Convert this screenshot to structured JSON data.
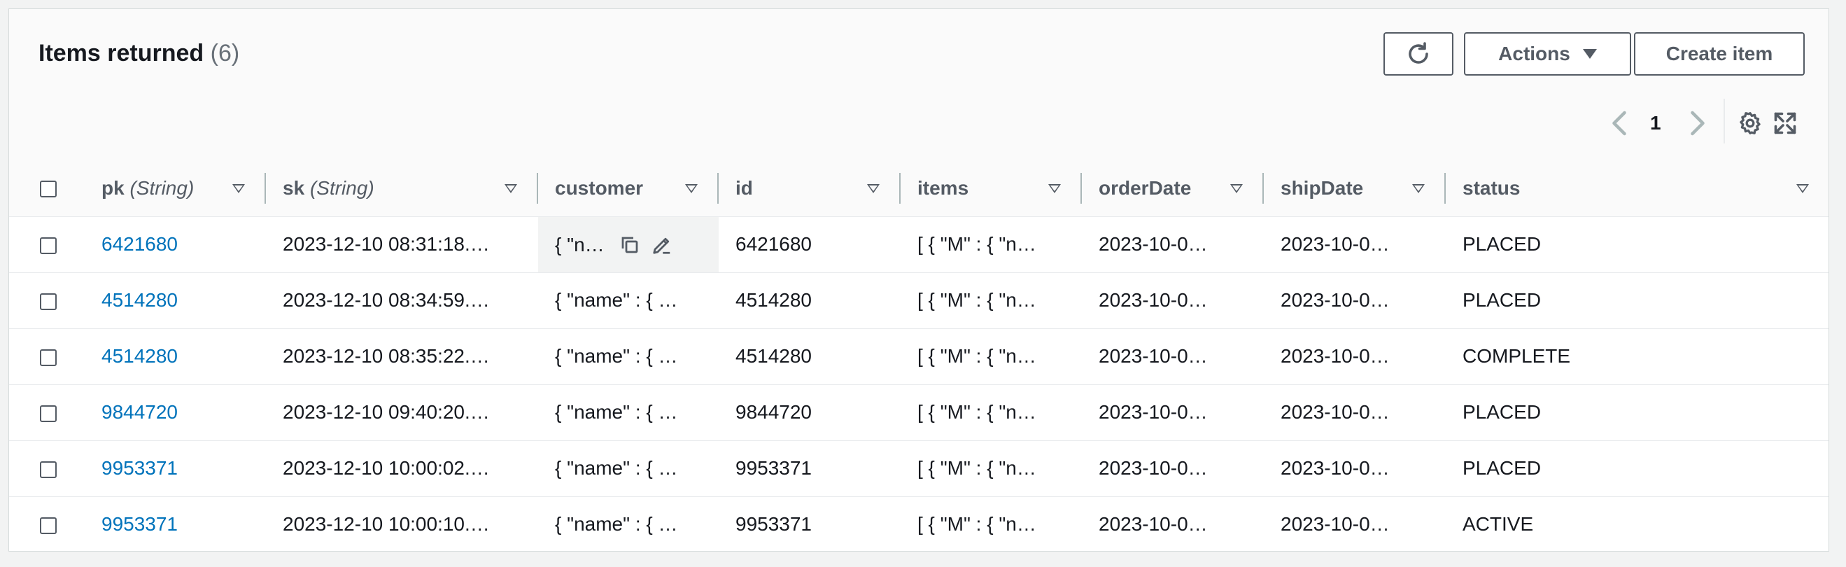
{
  "header": {
    "title": "Items returned",
    "count": "(6)",
    "actions_label": "Actions",
    "create_label": "Create item",
    "page_number": "1"
  },
  "columns": [
    {
      "name": "pk",
      "type": "(String)"
    },
    {
      "name": "sk",
      "type": "(String)"
    },
    {
      "name": "customer",
      "type": ""
    },
    {
      "name": "id",
      "type": ""
    },
    {
      "name": "items",
      "type": ""
    },
    {
      "name": "orderDate",
      "type": ""
    },
    {
      "name": "shipDate",
      "type": ""
    },
    {
      "name": "status",
      "type": ""
    }
  ],
  "rows": [
    {
      "pk": "6421680",
      "sk": "2023-12-10 08:31:18.…",
      "customer": "{ \"n…",
      "id": "6421680",
      "items": "[ { \"M\" : { \"n…",
      "orderDate": "2023-10-0…",
      "shipDate": "2023-10-0…",
      "status": "PLACED"
    },
    {
      "pk": "4514280",
      "sk": "2023-12-10 08:34:59.…",
      "customer": "{ \"name\" : { …",
      "id": "4514280",
      "items": "[ { \"M\" : { \"n…",
      "orderDate": "2023-10-0…",
      "shipDate": "2023-10-0…",
      "status": "PLACED"
    },
    {
      "pk": "4514280",
      "sk": "2023-12-10 08:35:22.…",
      "customer": "{ \"name\" : { …",
      "id": "4514280",
      "items": "[ { \"M\" : { \"n…",
      "orderDate": "2023-10-0…",
      "shipDate": "2023-10-0…",
      "status": "COMPLETE"
    },
    {
      "pk": "9844720",
      "sk": "2023-12-10 09:40:20.…",
      "customer": "{ \"name\" : { …",
      "id": "9844720",
      "items": "[ { \"M\" : { \"n…",
      "orderDate": "2023-10-0…",
      "shipDate": "2023-10-0…",
      "status": "PLACED"
    },
    {
      "pk": "9953371",
      "sk": "2023-12-10 10:00:02.…",
      "customer": "{ \"name\" : { …",
      "id": "9953371",
      "items": "[ { \"M\" : { \"n…",
      "orderDate": "2023-10-0…",
      "shipDate": "2023-10-0…",
      "status": "PLACED"
    },
    {
      "pk": "9953371",
      "sk": "2023-12-10 10:00:10.…",
      "customer": "{ \"name\" : { …",
      "id": "9953371",
      "items": "[ { \"M\" : { \"n…",
      "orderDate": "2023-10-0…",
      "shipDate": "2023-10-0…",
      "status": "ACTIVE"
    }
  ],
  "icons": {
    "refresh": "refresh-icon",
    "actions_caret": "caret-down-icon",
    "prev": "chevron-left-icon",
    "next": "chevron-right-icon",
    "settings": "gear-icon",
    "fullscreen": "expand-icon",
    "copy": "copy-icon",
    "edit": "pencil-icon"
  },
  "colors": {
    "link": "#0073bb",
    "text": "#16191f",
    "secondary": "#545b64",
    "muted": "#687078"
  }
}
